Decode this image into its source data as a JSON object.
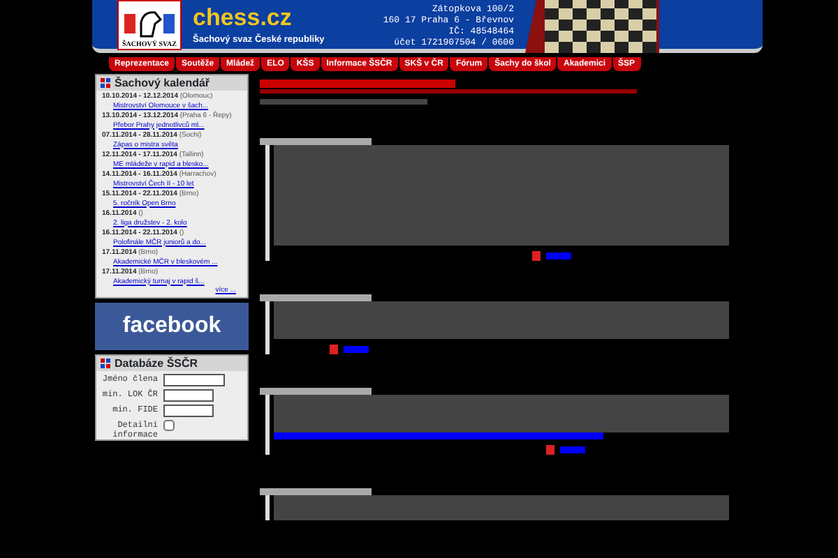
{
  "header": {
    "logo_text": "ŠACHOVÝ SVAZ",
    "site": "chess.cz",
    "subtitle": "Šachový svaz České republiky",
    "address": [
      "Zátopkova 100/2",
      "160 17 Praha 6 - Břevnov",
      "IČ: 48548464",
      "účet 1721907504 / 0600"
    ]
  },
  "nav": [
    "Reprezentace",
    "Soutěže",
    "Mládež",
    "ELO",
    "KŠS",
    "Informace ŠSČR",
    "SKŠ v ČR",
    "Fórum",
    "Šachy do škol",
    "Akademici",
    "ŠSP"
  ],
  "calendar": {
    "title": "Šachový kalendář",
    "more": "více ...",
    "events": [
      {
        "dates": "10.10.2014 - 12.12.2014",
        "place": "(Olomouc)",
        "link": "Mistrovství Olomouce v šach..."
      },
      {
        "dates": "13.10.2014 - 13.12.2014",
        "place": "(Praha 6 - Řepy)",
        "link": "Přebor Prahy jednotlivců ml..."
      },
      {
        "dates": "07.11.2014 - 28.11.2014",
        "place": "(Sochi)",
        "link": "Zápas o mistra světa"
      },
      {
        "dates": "12.11.2014 - 17.11.2014",
        "place": "(Tallinn)",
        "link": "ME mládeže v rapid a blesko..."
      },
      {
        "dates": "14.11.2014 - 16.11.2014",
        "place": "(Harrachov)",
        "link": "Mistrovství Čech II - 10 let"
      },
      {
        "dates": "15.11.2014 - 22.11.2014",
        "place": "(Brno)",
        "link": "5. ročník Open Brno"
      },
      {
        "dates": "16.11.2014",
        "place": "()",
        "link": "2. liga družstev - 2. kolo"
      },
      {
        "dates": "16.11.2014 - 22.11.2014",
        "place": "()",
        "link": "Polofinále MČR juniorů a do..."
      },
      {
        "dates": "17.11.2014",
        "place": "(Brno)",
        "link": "Akademické MČR v bleskovém ..."
      },
      {
        "dates": "17.11.2014",
        "place": "(Brno)",
        "link": "Akademický turnaj v rapid š..."
      }
    ]
  },
  "facebook": "facebook",
  "database": {
    "title": "Databáze ŠSČR",
    "fields": [
      {
        "kind": "text",
        "label": "Jméno člena",
        "wide": true
      },
      {
        "kind": "text",
        "label": "min. LOK ČR",
        "wide": false
      },
      {
        "kind": "text",
        "label": "min. FIDE",
        "wide": false
      },
      {
        "kind": "checkbox",
        "label": "Detailní informace",
        "checked": false
      }
    ]
  },
  "news": [
    {
      "kind": "long"
    },
    {
      "kind": "short"
    },
    {
      "kind": "link"
    },
    {
      "kind": "cut"
    }
  ]
}
